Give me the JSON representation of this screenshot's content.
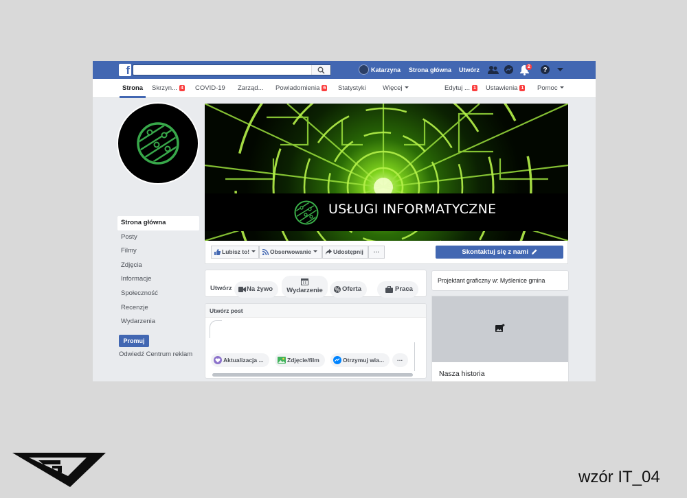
{
  "topbar": {
    "logo": "f",
    "user_name": "Katarzyna",
    "home_link": "Strona główna",
    "create_link": "Utwórz",
    "notifications_count": "2",
    "colors": {
      "bar": "#4267b2",
      "badge": "#fa3e3e"
    }
  },
  "page_nav": {
    "items": [
      {
        "label": "Strona",
        "badge": "",
        "caret": false,
        "active": true
      },
      {
        "label": "Skrzyn...",
        "badge": "4",
        "caret": false,
        "active": false
      },
      {
        "label": "COVID-19",
        "badge": "",
        "caret": false,
        "active": false
      },
      {
        "label": "Zarząd...",
        "badge": "",
        "caret": false,
        "active": false
      },
      {
        "label": "Powiadomienia",
        "badge": "6",
        "caret": false,
        "active": false
      },
      {
        "label": "Statystyki",
        "badge": "",
        "caret": false,
        "active": false
      },
      {
        "label": "Więcej",
        "badge": "",
        "caret": true,
        "active": false
      },
      {
        "label": "Edytuj ...",
        "badge": "1",
        "caret": false,
        "active": false
      },
      {
        "label": "Ustawienia",
        "badge": "1",
        "caret": false,
        "active": false
      },
      {
        "label": "Pomoc",
        "badge": "",
        "caret": true,
        "active": false
      }
    ]
  },
  "left_nav": {
    "items": [
      "Strona główna",
      "Posty",
      "Filmy",
      "Zdjęcia",
      "Informacje",
      "Społeczność",
      "Recenzje",
      "Wydarzenia"
    ],
    "promote_label": "Promuj",
    "ad_center_link": "Odwiedź Centrum reklam"
  },
  "cover": {
    "title": "USŁUGI INFORMATYCZNE",
    "accent_color": "#9be03c"
  },
  "actions": {
    "like": "Lubisz to!",
    "follow": "Obserwowanie",
    "share": "Udostępnij",
    "more": "···",
    "contact": "Skontaktuj się z nami"
  },
  "create_bar": {
    "label": "Utwórz",
    "live": "Na żywo",
    "event": "Wydarzenie",
    "offer": "Oferta",
    "job": "Praca"
  },
  "post_box": {
    "header": "Utwórz post",
    "update": "Aktualizacja ...",
    "photo": "Zdjęcie/film",
    "messages": "Otrzymuj wia...",
    "more": "···"
  },
  "right_col": {
    "about": "Projektant graficzny w: Myślenice gmina",
    "story_title": "Nasza historia"
  },
  "footer": {
    "pattern_label": "wzór IT_04"
  }
}
